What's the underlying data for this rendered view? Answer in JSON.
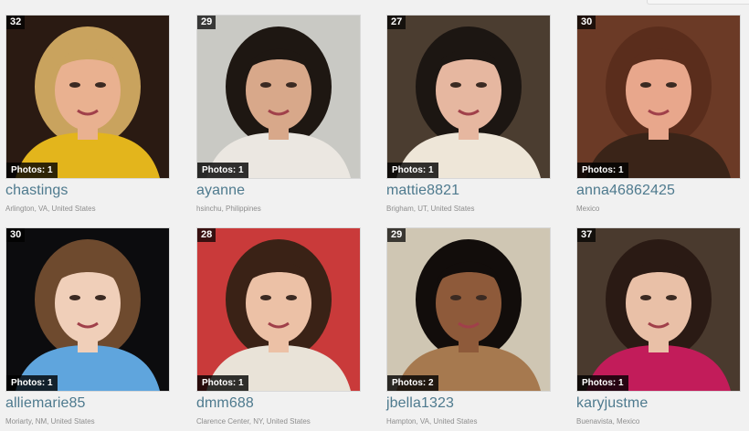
{
  "profiles": [
    {
      "username": "chastings",
      "age": "32",
      "photos": "Photos: 1",
      "location": "Arlington, VA, United States",
      "colors": {
        "bg": "#2a1a12",
        "hair": "#c9a35e",
        "skin": "#e9b190",
        "shirt": "#e3b51c"
      }
    },
    {
      "username": "ayanne",
      "age": "29",
      "photos": "Photos: 1",
      "location": "hsinchu, Philippines",
      "colors": {
        "bg": "#c9c9c4",
        "hair": "#1e1712",
        "skin": "#d8a88a",
        "shirt": "#ebe7e1"
      }
    },
    {
      "username": "mattie8821",
      "age": "27",
      "photos": "Photos: 1",
      "location": "Brigham, UT, United States",
      "colors": {
        "bg": "#4b3d30",
        "hair": "#1c1612",
        "skin": "#e6b7a0",
        "shirt": "#eee6d8"
      }
    },
    {
      "username": "anna46862425",
      "age": "30",
      "photos": "Photos: 1",
      "location": "Mexico",
      "colors": {
        "bg": "#6b3a26",
        "hair": "#5a2d1c",
        "skin": "#e8a78c",
        "shirt": "#3a2418"
      }
    },
    {
      "username": "alliemarie85",
      "age": "30",
      "photos": "Photos: 1",
      "location": "Moriarty, NM, United States",
      "colors": {
        "bg": "#0c0c0e",
        "hair": "#6e4a2e",
        "skin": "#f0cfb9",
        "shirt": "#5fa5dd"
      }
    },
    {
      "username": "dmm688",
      "age": "28",
      "photos": "Photos: 1",
      "location": "Clarence Center, NY, United States",
      "colors": {
        "bg": "#c93a3a",
        "hair": "#3a2216",
        "skin": "#ecc1a6",
        "shirt": "#e9e3d8"
      }
    },
    {
      "username": "jbella1323",
      "age": "29",
      "photos": "Photos: 2",
      "location": "Hampton, VA, United States",
      "colors": {
        "bg": "#cfc6b3",
        "hair": "#120d0b",
        "skin": "#8e5a3a",
        "shirt": "#a6794f"
      }
    },
    {
      "username": "karyjustme",
      "age": "37",
      "photos": "Photos: 1",
      "location": "Buenavista, Mexico",
      "colors": {
        "bg": "#4a3a2e",
        "hair": "#2a1a14",
        "skin": "#e9c0a7",
        "shirt": "#c21c5a"
      }
    }
  ]
}
